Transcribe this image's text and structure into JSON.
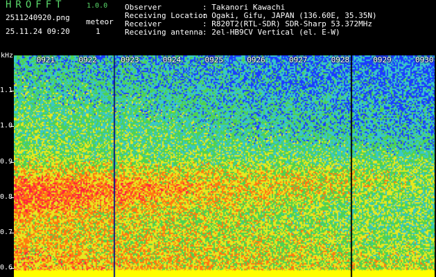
{
  "app": {
    "logo": "HROFFT",
    "version": "1.0.0",
    "filename": "2511240920.png",
    "datetime": "25.11.24 09:20",
    "meteor_label": "meteor",
    "meteor_count": "1"
  },
  "info": {
    "rows": [
      {
        "key": "Observer",
        "value": ": Takanori Kawachi"
      },
      {
        "key": "Receiving Location",
        "value": ": Ogaki, Gifu, JAPAN (136.60E, 35.35N)"
      },
      {
        "key": "Receiver",
        "value": ": R820T2(RTL-SDR) SDR-Sharp 53.372MHz"
      },
      {
        "key": "Receiving antenna",
        "value": ": 2el-HB9CV Vertical (el. E-W)"
      }
    ]
  },
  "spectrogram": {
    "y_unit": "kHz",
    "y_ticks": [
      "1.1",
      "1.0",
      "0.9",
      "0.8",
      "0.7",
      "0.6"
    ],
    "y_range": [
      0.575,
      1.2
    ],
    "x_ticks": [
      "0921",
      "0922",
      "0923",
      "0924",
      "0925",
      "0926",
      "0927",
      "0928",
      "0929",
      "0930"
    ],
    "x_range_minutes": [
      0,
      10
    ],
    "meteor_times_minutes": [
      2.38,
      8.0
    ],
    "colors": {
      "noise_low": "#1a3cff",
      "noise_mid": "#38c8c8",
      "noise_green": "#4fd24f",
      "noise_yellow": "#e8e820",
      "noise_orange": "#ff7a10",
      "noise_red": "#ff2040",
      "floor_band": "#ffff00"
    }
  }
}
